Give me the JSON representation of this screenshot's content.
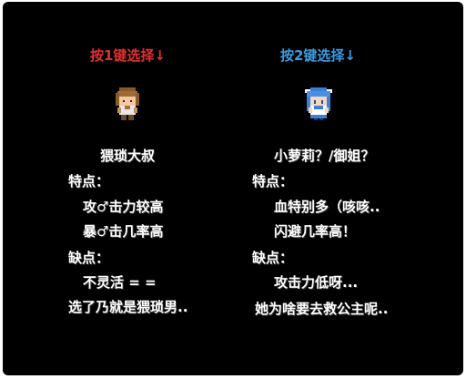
{
  "choices": [
    {
      "prompt": "按1键选择↓",
      "prompt_color": "#e03030",
      "sprite_icon": "brown-haired-man-sprite-icon",
      "name": "猥琐大叔",
      "pros_label": "特点：",
      "pros": [
        "攻♂击力较高",
        "暴♂击几率高"
      ],
      "cons_label": "缺点：",
      "cons": [
        "不灵活 = ="
      ],
      "closing": "选了乃就是猥琐男.."
    },
    {
      "prompt": "按2键选择↓",
      "prompt_color": "#3a9be0",
      "sprite_icon": "blue-haired-girl-sprite-icon",
      "name": "小萝莉？/御姐？",
      "pros_label": "特点：",
      "pros": [
        "血特别多（咳咳..",
        "闪避几率高！"
      ],
      "cons_label": "缺点：",
      "cons": [
        "攻击力低呀..."
      ],
      "closing": "她为啥要去救公主呢.."
    }
  ]
}
